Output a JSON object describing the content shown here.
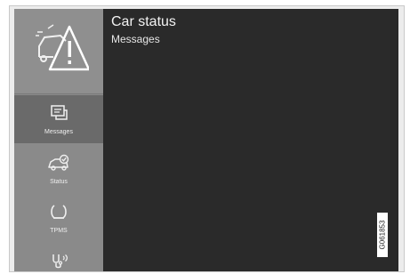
{
  "header": {
    "title": "Car status",
    "subtitle": "Messages"
  },
  "sidebar": {
    "top_icon": "car-warning-icon",
    "items": [
      {
        "label": "Messages",
        "icon": "messages-icon",
        "active": true
      },
      {
        "label": "Status",
        "icon": "car-status-icon",
        "active": false
      },
      {
        "label": "TPMS",
        "icon": "tpms-icon",
        "active": false
      },
      {
        "label": "",
        "icon": "service-icon",
        "active": false
      }
    ]
  },
  "figure_code": "G061853",
  "colors": {
    "screen_background": "#2a2a2a",
    "sidebar_background": "#8a8a8a",
    "active_item": "#6a6a6a",
    "text": "#f2f2f2"
  }
}
